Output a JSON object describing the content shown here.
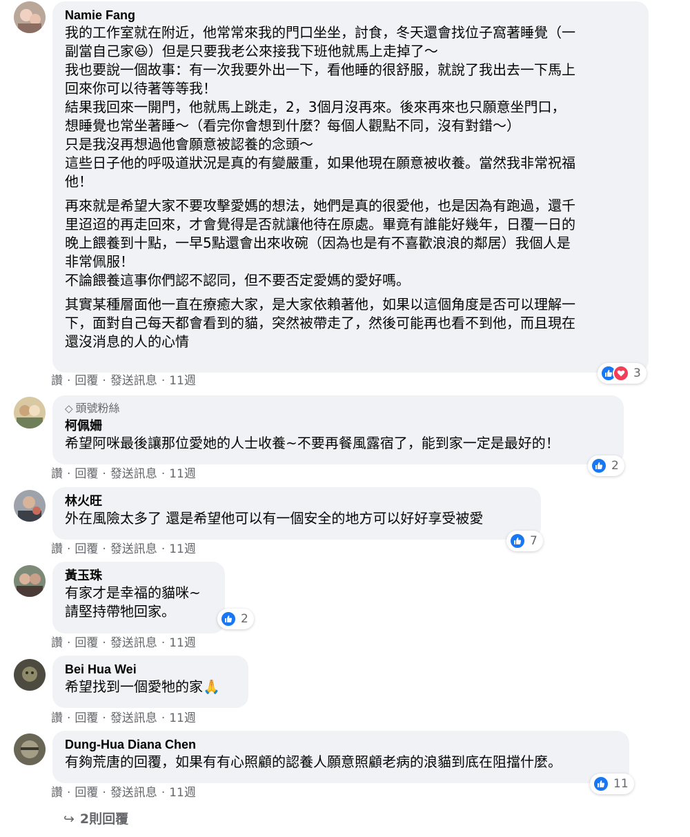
{
  "comments": [
    {
      "author": "Namie Fang",
      "paragraphs": [
        "我的工作室就在附近，他常常來我的門口坐坐，討食，冬天還會找位子窩著睡覺（一\n副當自己家😆）但是只要我老公來接我下班他就馬上走掉了～\n我也要說一個故事：有一次我要外出一下，看他睡的很舒服，就說了我出去一下馬上\n回來你可以待著等等我！\n結果我回來一開門，他就馬上跳走，2，3個月沒再來。後來再來也只願意坐門口，\n想睡覺也常坐著睡～（看完你會想到什麼？每個人觀點不同，沒有對錯～）\n只是我沒再想過他會願意被認養的念頭～\n這些日子他的呼吸道狀況是真的有變嚴重，如果他現在願意被收養。當然我非常祝福\n他！",
        "再來就是希望大家不要攻擊愛媽的想法，她們是真的很愛他，也是因為有跑過，還千\n里迢迢的再走回來，才會覺得是否就讓他待在原處。畢竟有誰能好幾年，日覆一日的\n晚上餵養到十點，一早5點還會出來收碗（因為也是有不喜歡浪浪的鄰居）我個人是\n非常佩服！\n不論餵養這事你們認不認同，但不要否定愛媽的愛好嗎。",
        "其實某種層面他一直在療癒大家，是大家依賴著他，如果以這個角度是否可以理解一\n下，面對自己每天都會看到的貓，突然被帶走了，然後可能再也看不到他，而且現在\n還沒消息的人的心情"
      ],
      "actions": [
        "讚",
        "回覆",
        "發送訊息",
        "11週"
      ],
      "reactions": {
        "icons": [
          "like-icon",
          "love-icon"
        ],
        "count": "3"
      }
    },
    {
      "badge": "頭號粉絲",
      "author": "柯佩姍",
      "paragraphs": [
        "希望阿咪最後讓那位愛她的人士收養~不要再餐風露宿了，能到家一定是最好的！"
      ],
      "actions": [
        "讚",
        "回覆",
        "發送訊息",
        "11週"
      ],
      "reactions": {
        "icons": [
          "like-icon"
        ],
        "count": "2"
      }
    },
    {
      "author": "林火旺",
      "paragraphs": [
        "外在風險太多了 還是希望他可以有一個安全的地方可以好好享受被愛"
      ],
      "actions": [
        "讚",
        "回覆",
        "發送訊息",
        "11週"
      ],
      "reactions": {
        "icons": [
          "like-icon"
        ],
        "count": "7"
      }
    },
    {
      "author": "黃玉珠",
      "paragraphs": [
        "有家才是幸福的貓咪~\n請堅持帶牠回家。"
      ],
      "actions": [
        "讚",
        "回覆",
        "發送訊息",
        "11週"
      ],
      "reactions": {
        "icons": [
          "like-icon"
        ],
        "count": "2"
      }
    },
    {
      "author": "Bei Hua Wei",
      "paragraphs": [
        "希望找到一個愛牠的家🙏"
      ],
      "actions": [
        "讚",
        "回覆",
        "發送訊息",
        "11週"
      ]
    },
    {
      "author": "Dung-Hua Diana Chen",
      "paragraphs": [
        "有夠荒唐的回覆，如果有有心照顧的認養人願意照顧老病的浪貓到底在阻擋什麼。"
      ],
      "actions": [
        "讚",
        "回覆",
        "發送訊息",
        "11週"
      ],
      "reactions": {
        "icons": [
          "like-icon"
        ],
        "count": "11"
      }
    }
  ],
  "view_replies": "2則回覆",
  "colors": {
    "like": "#1877f2",
    "love": "#f33e58",
    "bubble": "#f0f2f5",
    "meta": "#65676b"
  }
}
